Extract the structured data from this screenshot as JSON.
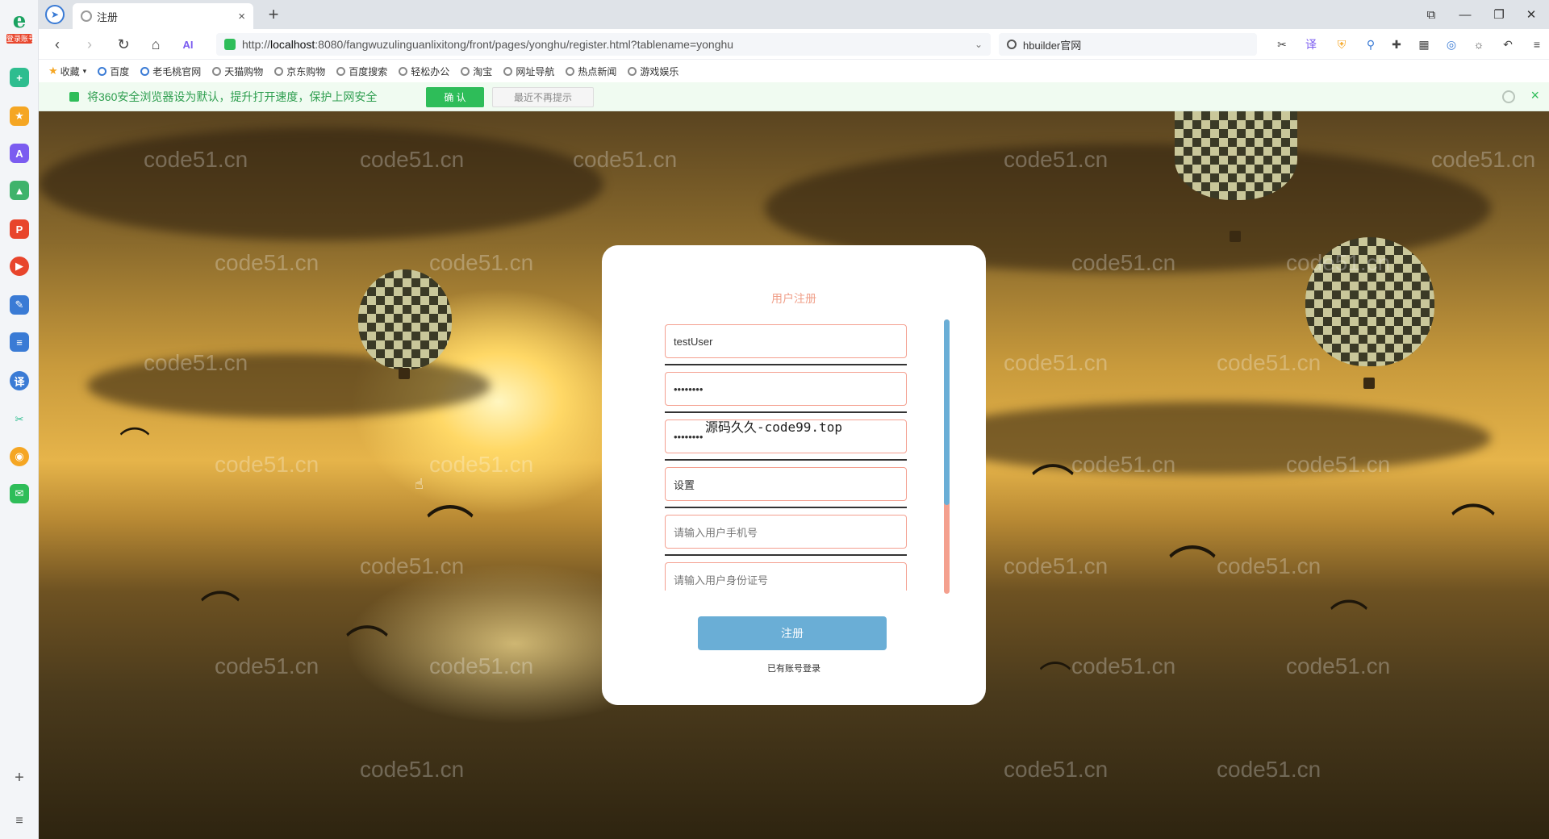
{
  "sidebar": {
    "logo_letter": "e",
    "logo_tag": "登录账号"
  },
  "tab": {
    "title": "注册",
    "close": "×",
    "new": "+"
  },
  "window_controls": [
    "⧉",
    "—",
    "❐",
    "✕"
  ],
  "address": {
    "protocol_host_prefix": "http://",
    "host": "localhost",
    "rest": ":8080/fangwuzulinguanlixitong/front/pages/yonghu/register.html?tablename=yonghu",
    "tail": "⌄"
  },
  "search": {
    "value": "hbuilder官网"
  },
  "bookmarks": [
    "收藏",
    "百度",
    "老毛桃官网",
    "天猫购物",
    "京东购物",
    "百度搜索",
    "轻松办公",
    "淘宝",
    "网址导航",
    "热点新闻",
    "游戏娱乐"
  ],
  "notify": {
    "message": "将360安全浏览器设为默认，提升打开速度，保护上网安全",
    "confirm": "确 认",
    "later": "最近不再提示",
    "close": "×"
  },
  "watermark_text": "code51.cn",
  "form": {
    "title": "用户注册",
    "username": "testUser",
    "password": "••••••••",
    "password_confirm": "••••••••",
    "name": "设置",
    "phone_placeholder": "请输入用户手机号",
    "idcard_placeholder": "请输入用户身份证号",
    "overlay": "源码久久-code99.top",
    "submit": "注册",
    "login_link": "已有账号登录"
  },
  "colors": {
    "accent_button": "#6aaed6",
    "field_border": "#f4a090",
    "title": "#f0a08a",
    "notify_green": "#2ebd59"
  },
  "icons": {
    "back": "‹",
    "forward": "›",
    "reload": "↻",
    "home": "⌂",
    "plus": "+",
    "list": "≡",
    "cursor": "☝"
  }
}
